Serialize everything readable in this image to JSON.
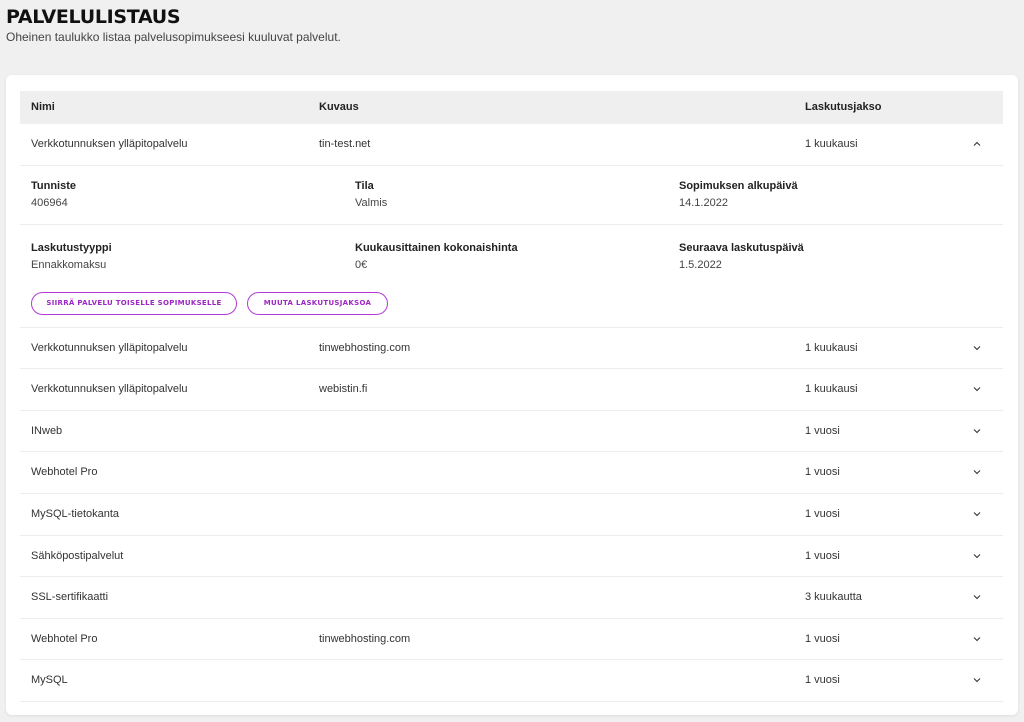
{
  "page": {
    "title": "PALVELULISTAUS",
    "subtitle": "Oheinen taulukko listaa palvelusopimukseesi kuuluvat palvelut."
  },
  "table": {
    "headers": {
      "name": "Nimi",
      "description": "Kuvaus",
      "billing_period": "Laskutusjakso"
    },
    "expanded_row": {
      "name": "Verkkotunnuksen ylläpitopalvelu",
      "description": "tin-test.net",
      "billing_period": "1 kuukausi",
      "chevron_icon": "chevron-up-icon",
      "details": {
        "identifier_label": "Tunniste",
        "identifier_value": "406964",
        "status_label": "Tila",
        "status_value": "Valmis",
        "start_date_label": "Sopimuksen alkupäivä",
        "start_date_value": "14.1.2022",
        "billing_type_label": "Laskutustyyppi",
        "billing_type_value": "Ennakkomaksu",
        "monthly_total_label": "Kuukausittainen kokonaishinta",
        "monthly_total_value": "0€",
        "next_billing_label": "Seuraava laskutuspäivä",
        "next_billing_value": "1.5.2022"
      },
      "actions": {
        "transfer_label": "SIIRRÄ PALVELU TOISELLE SOPIMUKSELLE",
        "change_period_label": "MUUTA LASKUTUSJAKSOA"
      },
      "accent_color": "#b23bd6"
    },
    "rows": [
      {
        "name": "Verkkotunnuksen ylläpitopalvelu",
        "description": "tinwebhosting.com",
        "billing_period": "1 kuukausi"
      },
      {
        "name": "Verkkotunnuksen ylläpitopalvelu",
        "description": "webistin.fi",
        "billing_period": "1 kuukausi"
      },
      {
        "name": "INweb",
        "description": "",
        "billing_period": "1 vuosi"
      },
      {
        "name": "Webhotel Pro",
        "description": "",
        "billing_period": "1 vuosi"
      },
      {
        "name": "MySQL-tietokanta",
        "description": "",
        "billing_period": "1 vuosi"
      },
      {
        "name": "Sähköpostipalvelut",
        "description": "",
        "billing_period": "1 vuosi"
      },
      {
        "name": "SSL-sertifikaatti",
        "description": "",
        "billing_period": "3 kuukautta"
      },
      {
        "name": "Webhotel Pro",
        "description": "tinwebhosting.com",
        "billing_period": "1 vuosi"
      },
      {
        "name": "MySQL",
        "description": "",
        "billing_period": "1 vuosi"
      }
    ],
    "row_chevron_icon": "chevron-down-icon"
  }
}
